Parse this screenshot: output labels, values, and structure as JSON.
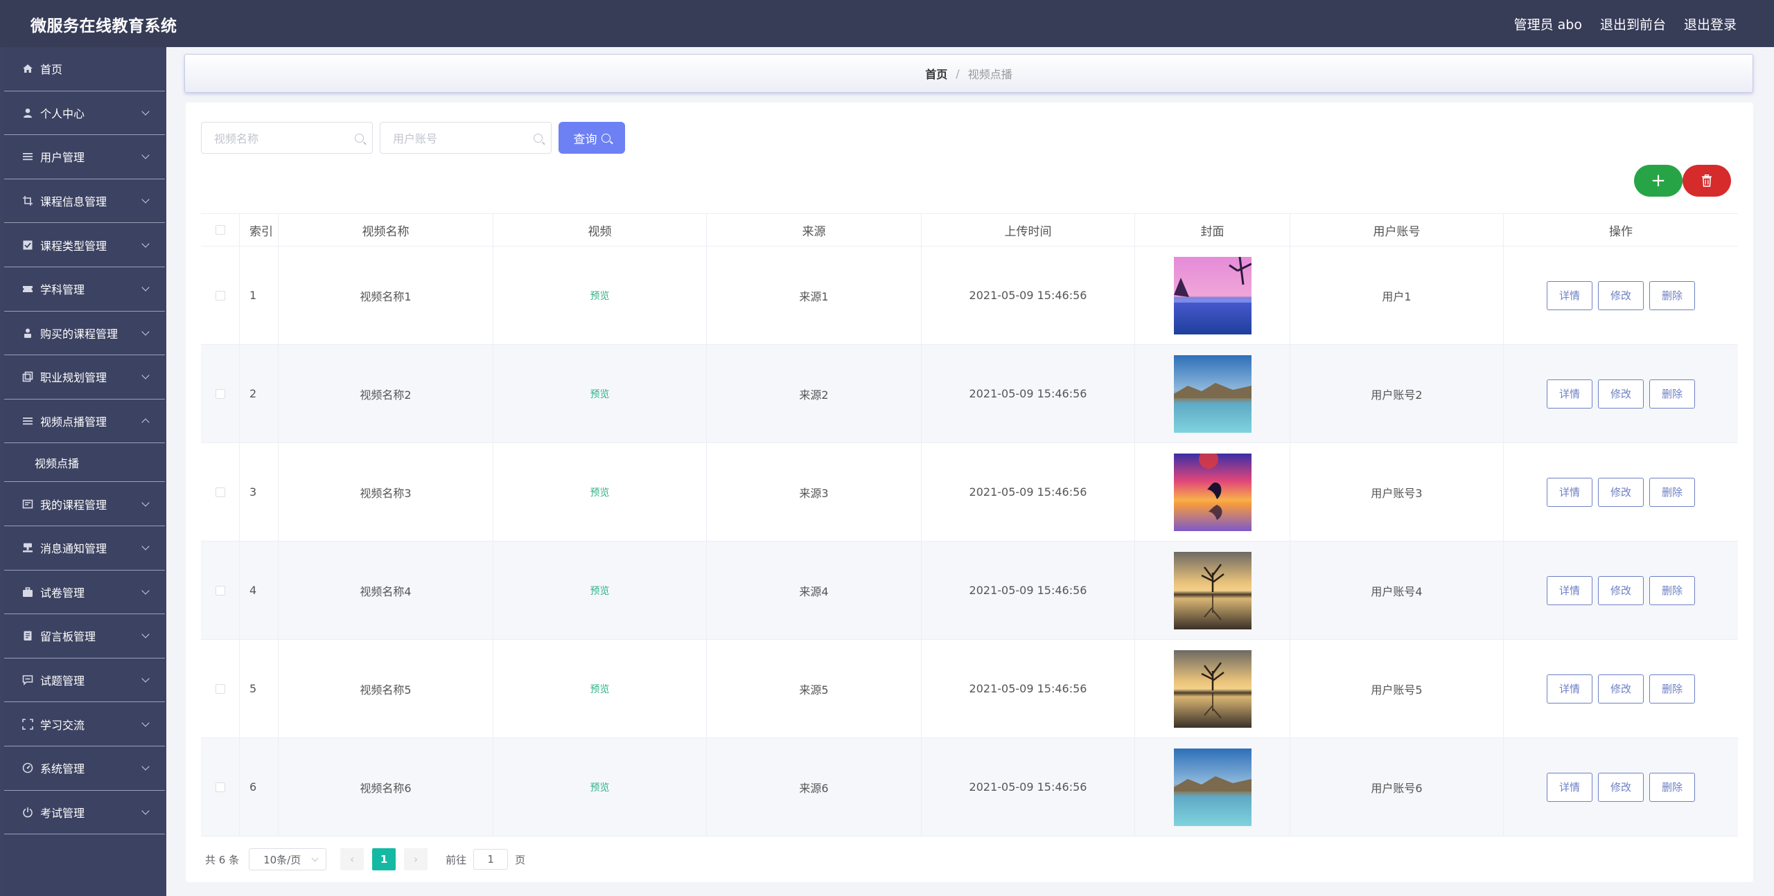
{
  "header": {
    "brand": "微服务在线教育系统",
    "admin": "管理员 abo",
    "exit_front": "退出到前台",
    "logout": "退出登录"
  },
  "sidebar": {
    "items": [
      {
        "label": "首页",
        "icon": "home-icon",
        "expandable": false
      },
      {
        "label": "个人中心",
        "icon": "user-icon",
        "expandable": true
      },
      {
        "label": "用户管理",
        "icon": "list-icon",
        "expandable": true
      },
      {
        "label": "课程信息管理",
        "icon": "crop-icon",
        "expandable": true
      },
      {
        "label": "课程类型管理",
        "icon": "checkbox-icon",
        "expandable": true
      },
      {
        "label": "学科管理",
        "icon": "ticket-icon",
        "expandable": true
      },
      {
        "label": "购买的课程管理",
        "icon": "person-icon",
        "expandable": true
      },
      {
        "label": "职业规划管理",
        "icon": "copy-icon",
        "expandable": true
      },
      {
        "label": "视频点播管理",
        "icon": "list-icon",
        "expandable": true,
        "expanded": true
      },
      {
        "label": "我的课程管理",
        "icon": "message-icon",
        "expandable": true
      },
      {
        "label": "消息通知管理",
        "icon": "stamp-icon",
        "expandable": true
      },
      {
        "label": "试卷管理",
        "icon": "briefcase-icon",
        "expandable": true
      },
      {
        "label": "留言板管理",
        "icon": "notebook-icon",
        "expandable": true
      },
      {
        "label": "试题管理",
        "icon": "chat-icon",
        "expandable": true
      },
      {
        "label": "学习交流",
        "icon": "fullscreen-icon",
        "expandable": true
      },
      {
        "label": "系统管理",
        "icon": "gauge-icon",
        "expandable": true
      },
      {
        "label": "考试管理",
        "icon": "power-icon",
        "expandable": true
      }
    ],
    "sub_item": "视频点播"
  },
  "breadcrumb": {
    "home": "首页",
    "sep": "/",
    "current": "视频点播"
  },
  "search": {
    "name_placeholder": "视频名称",
    "account_placeholder": "用户账号",
    "query_label": "查询"
  },
  "table": {
    "headers": [
      "索引",
      "视频名称",
      "视频",
      "来源",
      "上传时间",
      "封面",
      "用户账号",
      "操作"
    ],
    "rows": [
      {
        "idx": "1",
        "name": "视频名称1",
        "video": "预览",
        "source": "来源1",
        "time": "2021-05-09 15:46:56",
        "user": "用户1",
        "cover": "pink-sunset"
      },
      {
        "idx": "2",
        "name": "视频名称2",
        "video": "预览",
        "source": "来源2",
        "time": "2021-05-09 15:46:56",
        "user": "用户账号2",
        "cover": "lake-blue"
      },
      {
        "idx": "3",
        "name": "视频名称3",
        "video": "预览",
        "source": "来源3",
        "time": "2021-05-09 15:46:56",
        "user": "用户账号3",
        "cover": "dolphin-sunset"
      },
      {
        "idx": "4",
        "name": "视频名称4",
        "video": "预览",
        "source": "来源4",
        "time": "2021-05-09 15:46:56",
        "user": "用户账号4",
        "cover": "tree-lake"
      },
      {
        "idx": "5",
        "name": "视频名称5",
        "video": "预览",
        "source": "来源5",
        "time": "2021-05-09 15:46:56",
        "user": "用户账号5",
        "cover": "tree-lake"
      },
      {
        "idx": "6",
        "name": "视频名称6",
        "video": "预览",
        "source": "来源6",
        "time": "2021-05-09 15:46:56",
        "user": "用户账号6",
        "cover": "lake-blue"
      }
    ],
    "ops": {
      "detail": "详情",
      "edit": "修改",
      "delete": "删除"
    }
  },
  "pagination": {
    "total": "共 6 条",
    "page_size": "10条/页",
    "prev": "‹",
    "next": "›",
    "current_page": "1",
    "goto_label": "前往",
    "goto_value": "1",
    "page_unit": "页"
  },
  "colors": {
    "topbar": "#373c57",
    "sidebar": "#3c4261",
    "primary": "#6d80f4",
    "add": "#27a546",
    "delete": "#d62b2b",
    "page_active": "#15b9a3"
  }
}
